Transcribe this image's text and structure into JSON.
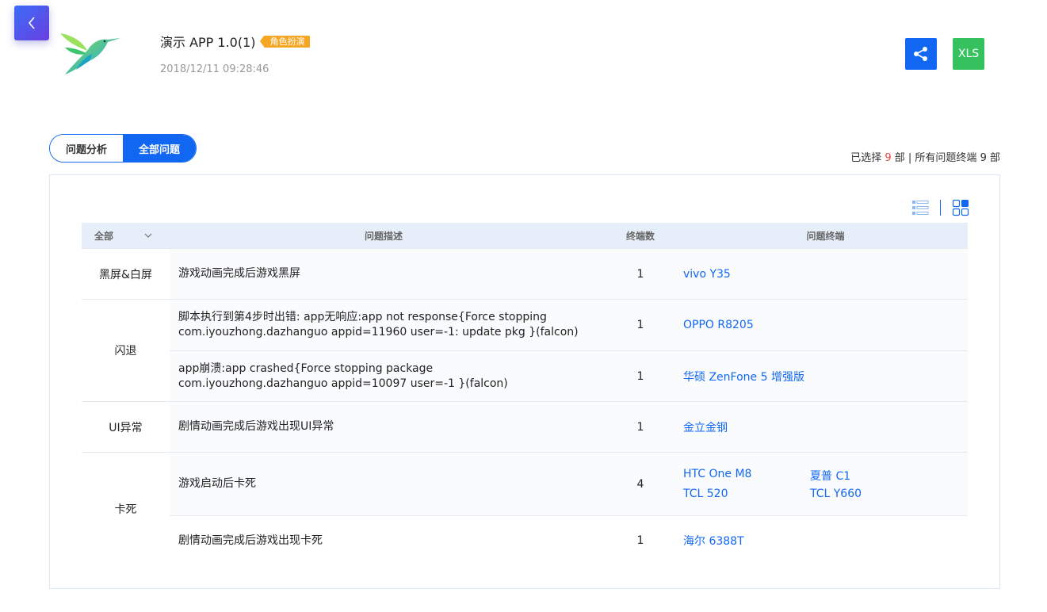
{
  "header": {
    "back_icon": "chevron-left-icon",
    "logo_icon": "hummingbird-logo",
    "app_title": "演示 APP 1.0(1)",
    "tag": "角色扮演",
    "timestamp": "2018/12/11 09:28:46",
    "share_icon": "share-icon",
    "xls_label": "XLS",
    "colors": {
      "primary": "#1267f2",
      "xls": "#36c15f",
      "tag": "#f5a623",
      "highlight": "#f0443d"
    }
  },
  "tabs": [
    {
      "label": "问题分析",
      "active": false
    },
    {
      "label": "全部问题",
      "active": true
    }
  ],
  "summary": {
    "prefix": "已选择",
    "selected": "9",
    "mid": "部 | 所有问题终端",
    "total": "9",
    "suffix": "部"
  },
  "view_toggle": {
    "list_icon": "list-view-icon",
    "grid_icon": "grid-view-icon"
  },
  "table": {
    "headers": {
      "category": "全部",
      "description": "问题描述",
      "count": "终端数",
      "devices": "问题终端"
    },
    "groups": [
      {
        "category": "黑屏&白屏",
        "rows": [
          {
            "description": "游戏动画完成后游戏黑屏",
            "count": "1",
            "devices": [
              "vivo Y35"
            ]
          }
        ]
      },
      {
        "category": "闪退",
        "rows": [
          {
            "description": "脚本执行到第4步时出错: app无响应:app not response{Force stopping com.iyouzhong.dazhanguo appid=11960 user=-1: update pkg }(falcon)",
            "count": "1",
            "devices": [
              "OPPO R8205"
            ]
          },
          {
            "description": "app崩溃:app crashed{Force stopping package com.iyouzhong.dazhanguo appid=10097 user=-1 }(falcon)",
            "count": "1",
            "devices": [
              "华硕 ZenFone 5 增强版"
            ]
          }
        ]
      },
      {
        "category": "UI异常",
        "rows": [
          {
            "description": "剧情动画完成后游戏出现UI异常",
            "count": "1",
            "devices": [
              "金立金钢"
            ]
          }
        ]
      },
      {
        "category": "卡死",
        "rows": [
          {
            "description": "游戏启动后卡死",
            "count": "4",
            "devices": [
              "HTC One M8",
              "夏普 C1",
              "TCL 520",
              "TCL Y660"
            ]
          },
          {
            "description": "剧情动画完成后游戏出现卡死",
            "count": "1",
            "devices": [
              "海尔 6388T"
            ]
          }
        ]
      }
    ]
  }
}
